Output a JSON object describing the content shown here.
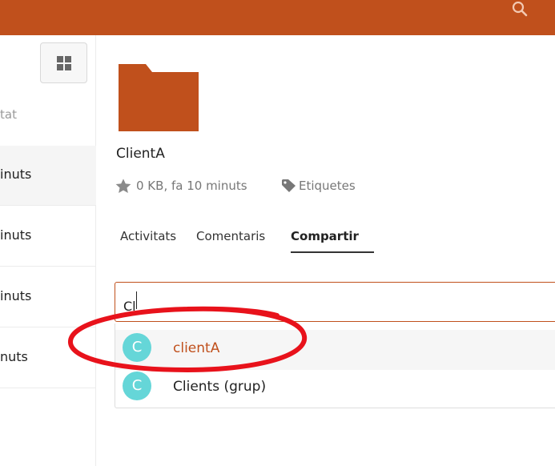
{
  "header": {
    "search_icon": "search-icon",
    "accent_color": "#c0501c"
  },
  "sidebar": {
    "view_toggle_icon": "grid-icon",
    "column_header": "tat",
    "rows": [
      {
        "text": "inuts"
      },
      {
        "text": "inuts"
      },
      {
        "text": "inuts"
      },
      {
        "text": "nuts"
      }
    ]
  },
  "details": {
    "folder_icon": "folder-icon",
    "file_name": "ClientA",
    "favorite_icon": "star-icon",
    "info": "0 KB, fa 10 minuts",
    "tags_icon": "tag-icon",
    "tags_label": "Etiquetes"
  },
  "tabs": [
    {
      "label": "Activitats",
      "active": false
    },
    {
      "label": "Comentaris",
      "active": false
    },
    {
      "label": "Compartir",
      "active": true
    }
  ],
  "sharing": {
    "input_value": "Cl",
    "suggestions": [
      {
        "avatar_letter": "C",
        "label": "clientA",
        "highlighted": true
      },
      {
        "avatar_letter": "C",
        "label": "Clients (grup)",
        "highlighted": false
      }
    ],
    "avatar_color": "#65d6d8"
  },
  "annotation": {
    "shape": "ellipse",
    "color": "#e8121b"
  }
}
